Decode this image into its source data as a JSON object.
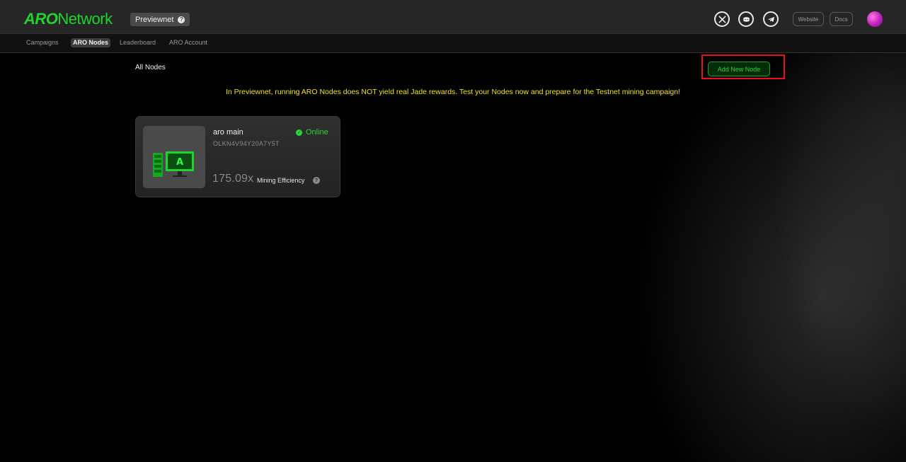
{
  "header": {
    "logo_bold": "ARO",
    "logo_regular": "Network",
    "env_badge": "Previewnet",
    "env_help": "?",
    "social": [
      "x-icon",
      "discord-icon",
      "telegram-icon"
    ],
    "website_label": "Website",
    "docs_label": "Docs"
  },
  "nav": {
    "tabs": [
      {
        "label": "Campaigns",
        "active": false
      },
      {
        "label": "ARO Nodes",
        "active": true
      },
      {
        "label": "Leaderboard",
        "active": false
      },
      {
        "label": "ARO Account",
        "active": false
      }
    ]
  },
  "main": {
    "title": "All Nodes",
    "add_button": "Add New Node",
    "notice": "In Previewnet, running ARO Nodes does NOT yield real Jade rewards. Test your Nodes now and prepare for the Testnet mining campaign!",
    "nodes": [
      {
        "name": "aro main",
        "id": "OLKN4V94Y20A7Y5T",
        "status": "Online",
        "efficiency_value": "175.09x",
        "efficiency_label": "Mining Efficiency",
        "thumb_letter": "A"
      }
    ]
  },
  "colors": {
    "brand_green": "#20d32d",
    "notice_yellow": "#f3e322",
    "highlight_red": "#e8101a"
  }
}
